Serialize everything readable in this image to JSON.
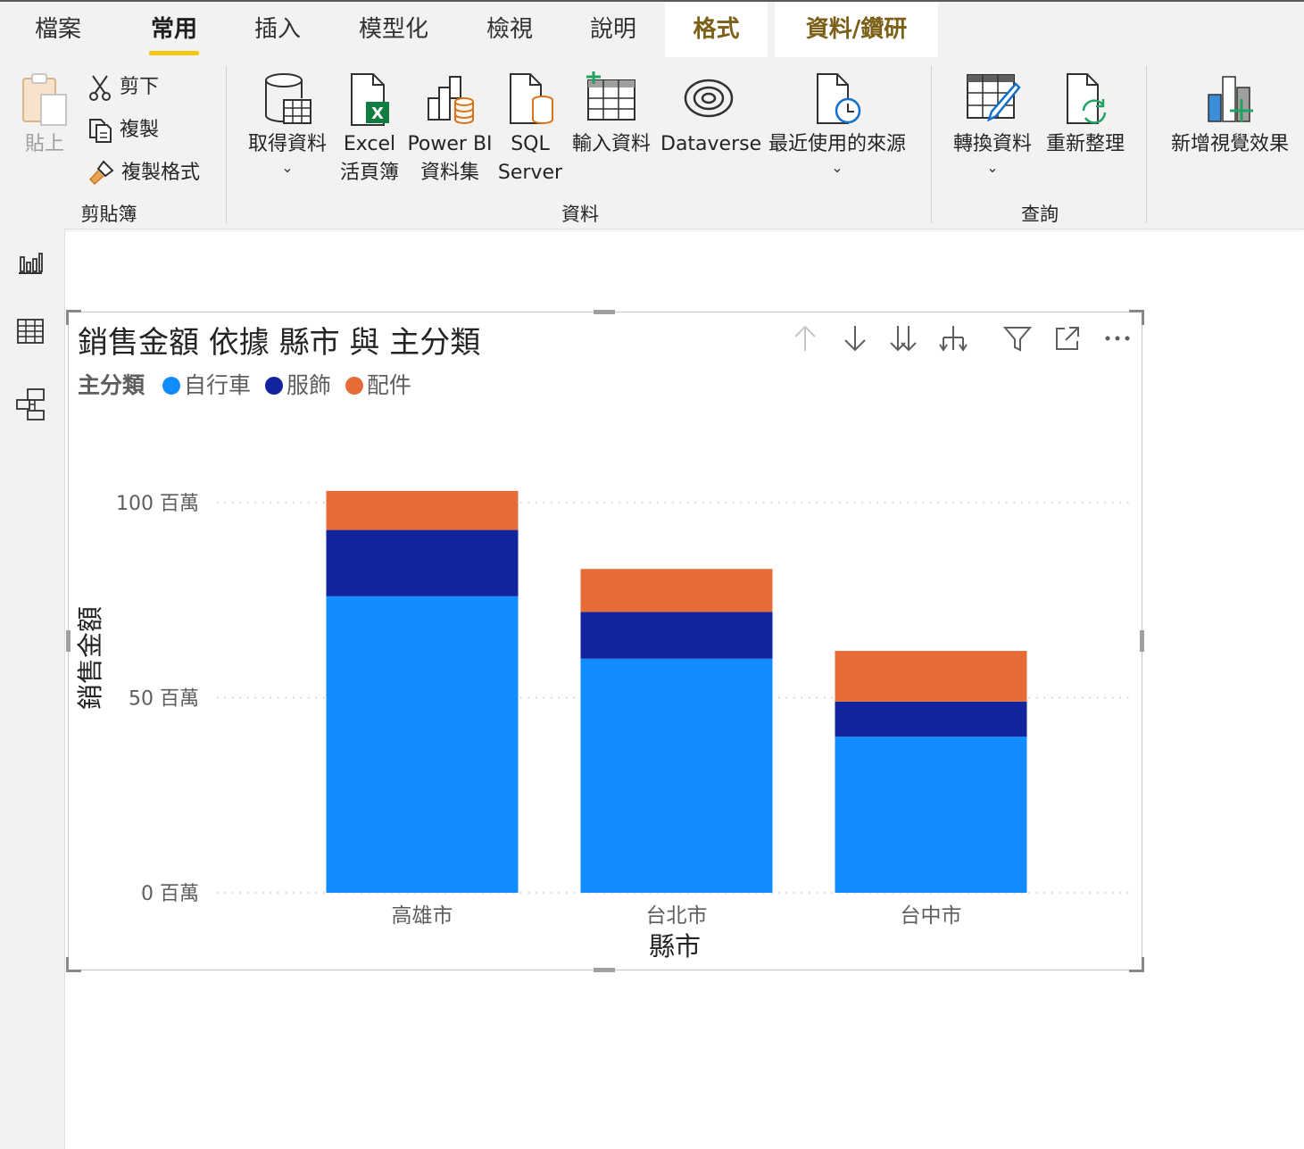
{
  "tabs": [
    {
      "label": "檔案",
      "active": false
    },
    {
      "label": "常用",
      "active": true
    },
    {
      "label": "插入",
      "active": false
    },
    {
      "label": "模型化",
      "active": false
    },
    {
      "label": "檢視",
      "active": false
    },
    {
      "label": "說明",
      "active": false
    },
    {
      "label": "格式",
      "active": false,
      "contextual": true
    },
    {
      "label": "資料/鑽研",
      "active": false,
      "contextual": true
    }
  ],
  "ribbon": {
    "clipboard": {
      "paste": "貼上",
      "cut": "剪下",
      "copy": "複製",
      "format_painter": "複製格式",
      "group_label": "剪貼簿"
    },
    "data": {
      "get_data": "取得資料",
      "excel_line1": "Excel",
      "excel_line2": "活頁簿",
      "pbi_line1": "Power BI",
      "pbi_line2": "資料集",
      "sql_line1": "SQL",
      "sql_line2": "Server",
      "enter_data": "輸入資料",
      "dataverse": "Dataverse",
      "recent_sources": "最近使用的來源",
      "group_label": "資料"
    },
    "queries": {
      "transform": "轉換資料",
      "refresh": "重新整理",
      "group_label": "查詢"
    },
    "insert": {
      "new_visual": "新增視覺效果"
    }
  },
  "colors": {
    "bike": "#118dff",
    "apparel": "#12239e",
    "accessory": "#e66c37",
    "accent_tab": "#f2c811"
  },
  "visual": {
    "title": "銷售金額 依據 縣市 與 主分類",
    "legend_title": "主分類"
  },
  "chart_data": {
    "type": "bar",
    "stacked": true,
    "title": "銷售金額 依據 縣市 與 主分類",
    "xlabel": "縣市",
    "ylabel": "銷售金額",
    "categories": [
      "高雄市",
      "台北市",
      "台中市"
    ],
    "series": [
      {
        "name": "自行車",
        "color": "#118dff",
        "values": [
          76,
          60,
          40
        ]
      },
      {
        "name": "服飾",
        "color": "#12239e",
        "values": [
          17,
          12,
          9
        ]
      },
      {
        "name": "配件",
        "color": "#e66c37",
        "values": [
          10,
          11,
          13
        ]
      }
    ],
    "ylim": [
      0,
      100
    ],
    "yticks": [
      0,
      50,
      100
    ],
    "ytick_labels": [
      "0 百萬",
      "50 百萬",
      "100 百萬"
    ],
    "grid": true,
    "legend_position": "top-left"
  }
}
